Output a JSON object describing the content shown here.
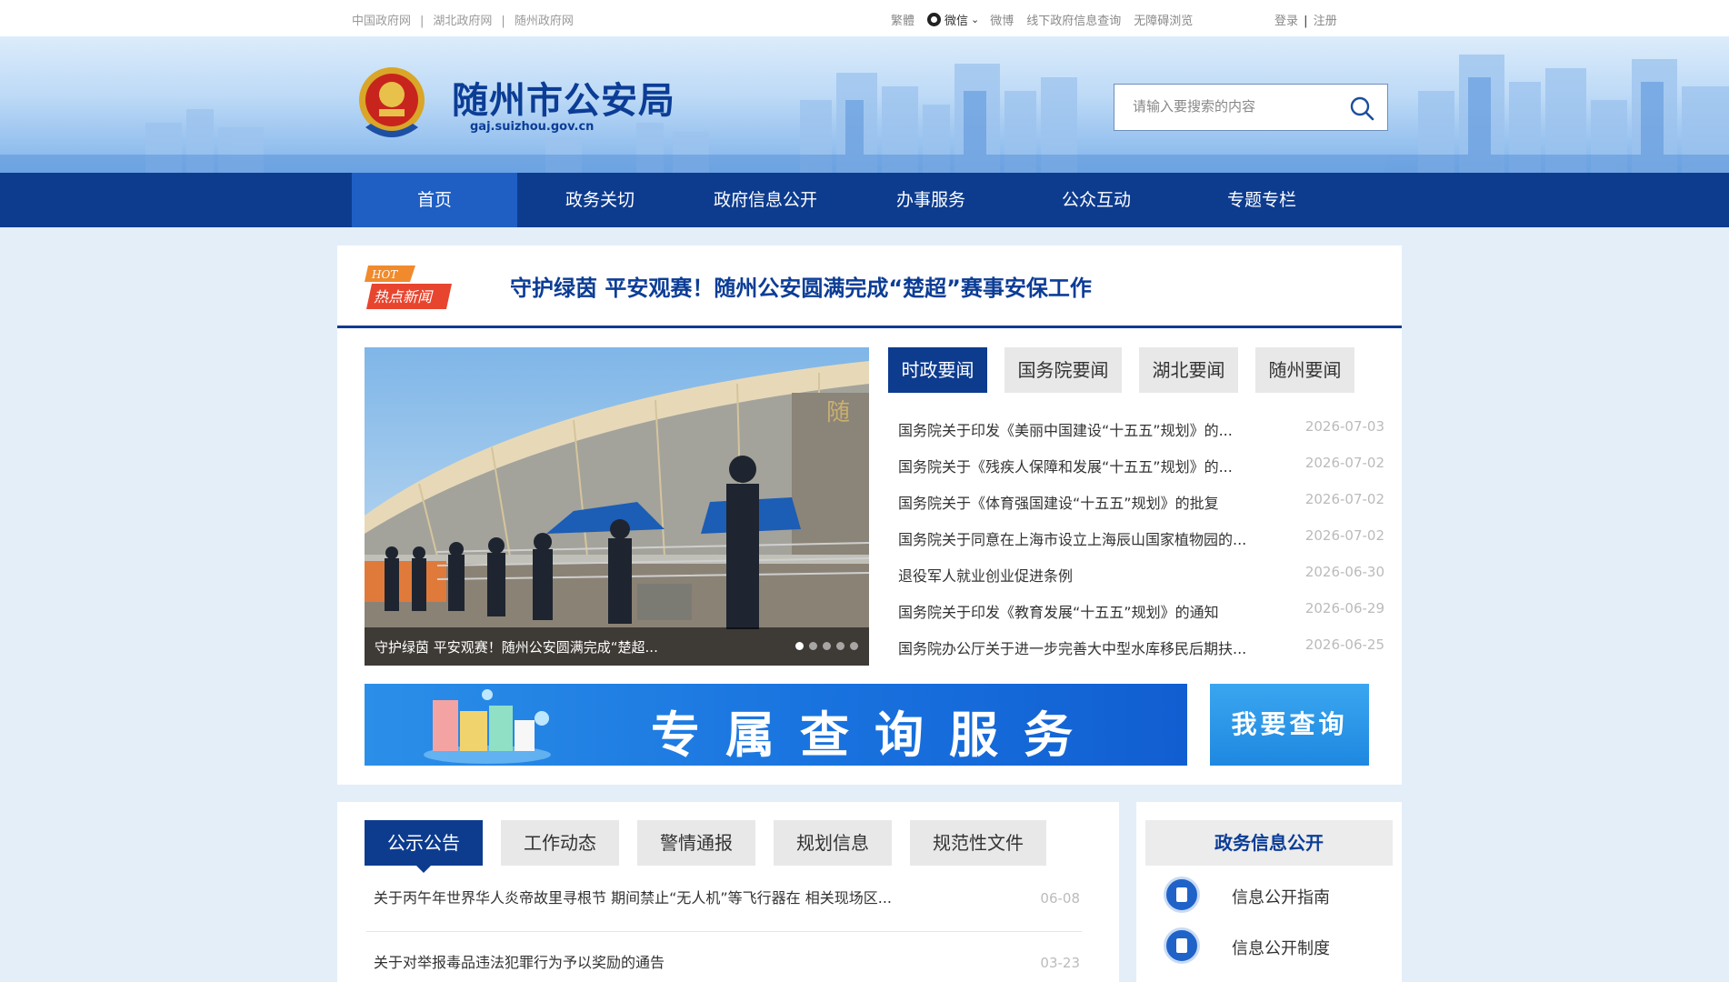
{
  "topbar": {
    "links": [
      "中国政府网",
      "湖北政府网",
      "随州政府网"
    ],
    "separator": "|",
    "traditional": "繁體",
    "wechat": "微信",
    "weibo": "微博",
    "offline_query": "线下政府信息查询",
    "accessibility": "无障碍浏览",
    "login": "登录",
    "login_sep": "|",
    "register": "注册"
  },
  "header": {
    "title": "随州市公安局",
    "domain": "gaj.suizhou.gov.cn",
    "search_placeholder": "请输入要搜索的内容"
  },
  "nav": {
    "items": [
      "首页",
      "政务关切",
      "政府信息公开",
      "办事服务",
      "公众互动",
      "专题专栏"
    ],
    "active_index": 0
  },
  "hot": {
    "badge_en": "HOT",
    "badge_cn": "热点新闻",
    "headline": "守护绿茵 平安观赛！随州公安圆满完成“楚超”赛事安保工作"
  },
  "slider": {
    "caption": "守护绿茵 平安观赛！随州公安圆满完成“楚超...",
    "dot_count": 5,
    "active_dot": 0,
    "stadium_sign": "随"
  },
  "news_tabs": {
    "items": [
      "时政要闻",
      "国务院要闻",
      "湖北要闻",
      "随州要闻"
    ],
    "active_index": 0
  },
  "news": [
    {
      "title": "国务院关于印发《美丽中国建设“十五五”规划》的...",
      "date": "2026-07-03"
    },
    {
      "title": "国务院关于《残疾人保障和发展“十五五”规划》的...",
      "date": "2026-07-02"
    },
    {
      "title": "国务院关于《体育强国建设“十五五”规划》的批复",
      "date": "2026-07-02"
    },
    {
      "title": "国务院关于同意在上海市设立上海辰山国家植物园的...",
      "date": "2026-07-02"
    },
    {
      "title": "退役军人就业创业促进条例",
      "date": "2026-06-30"
    },
    {
      "title": "国务院关于印发《教育发展“十五五”规划》的通知",
      "date": "2026-06-29"
    },
    {
      "title": "国务院办公厅关于进一步完善大中型水库移民后期扶...",
      "date": "2026-06-25"
    }
  ],
  "banner": {
    "title": "专属查询服务",
    "button": "我要查询"
  },
  "notice_tabs": {
    "items": [
      "公示公告",
      "工作动态",
      "警情通报",
      "规划信息",
      "规范性文件"
    ],
    "active_index": 0
  },
  "notices": [
    {
      "title": "关于丙午年世界华人炎帝故里寻根节 期间禁止“无人机”等飞行器在 相关现场区...",
      "date": "06-08"
    },
    {
      "title": "关于对举报毒品违法犯罪行为予以奖励的通告",
      "date": "03-23"
    }
  ],
  "gov_info": {
    "title": "政务信息公开",
    "links": [
      "信息公开指南",
      "信息公开制度"
    ]
  },
  "colors": {
    "brand_blue": "#0d3c8f",
    "nav_active": "#1f5fc4",
    "page_bg": "#e3eef8",
    "hot_red": "#e8452f"
  }
}
